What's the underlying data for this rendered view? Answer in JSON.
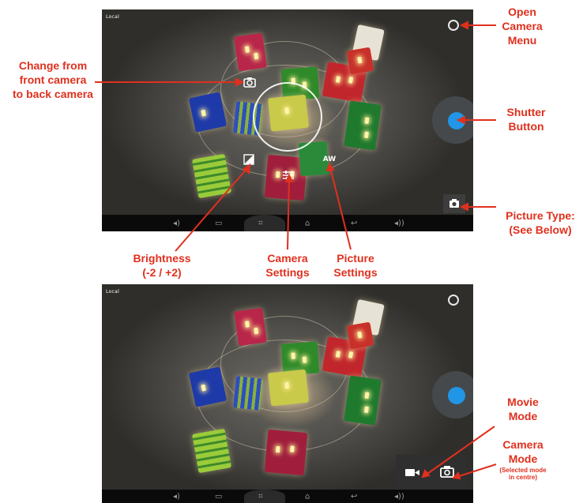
{
  "screen1": {
    "source_label": "Local",
    "nav_icons": [
      "volume-down-icon",
      "recent-apps-icon",
      "screenshot-icon",
      "home-icon",
      "back-icon",
      "volume-up-icon"
    ],
    "controls": {
      "brightness_icon": "brightness-icon",
      "settings_icon": "sliders-icon",
      "picture_settings": "AW",
      "switch_camera_icon": "camera-switch-icon"
    }
  },
  "screen2": {
    "source_label": "Local",
    "modes": [
      "movie-mode",
      "camera-mode"
    ]
  },
  "annotations": {
    "open_camera_menu": [
      "Open",
      "Camera",
      "Menu"
    ],
    "change_camera": [
      "Change from",
      "front camera",
      "to back camera"
    ],
    "shutter_button": [
      "Shutter",
      "Button"
    ],
    "picture_type": [
      "Picture Type:",
      "(See Below)"
    ],
    "brightness": [
      "Brightness",
      "(-2 / +2)"
    ],
    "camera_settings": [
      "Camera",
      "Settings"
    ],
    "picture_settings": [
      "Picture",
      "Settings"
    ],
    "movie_mode": [
      "Movie",
      "Mode"
    ],
    "camera_mode": [
      "Camera",
      "Mode"
    ],
    "camera_mode_note": [
      "(Selected mode",
      "in centre)"
    ]
  },
  "colors": {
    "annotation": "#e0301e",
    "shutter": "#2196e6",
    "navbar": "#0a0a0a"
  }
}
